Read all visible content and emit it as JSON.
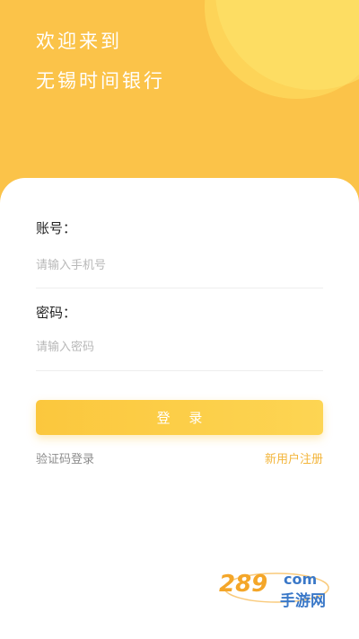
{
  "header": {
    "welcome_line1": "欢迎来到",
    "welcome_line2": "无锡时间银行"
  },
  "form": {
    "account_label": "账号：",
    "account_placeholder": "请输入手机号",
    "password_label": "密码：",
    "password_placeholder": "请输入密码",
    "login_button": "登 录",
    "code_login_link": "验证码登录",
    "register_link": "新用户注册"
  },
  "watermark": {
    "number": "289",
    "suffix": "com",
    "caption": "手游网"
  },
  "colors": {
    "brand_yellow": "#fbc349",
    "link_orange": "#f3b53a",
    "hint_gray": "#b8b8b8"
  }
}
